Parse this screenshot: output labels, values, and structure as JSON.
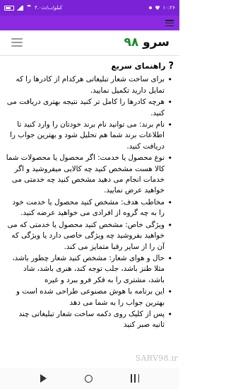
{
  "status_bar": {
    "time": "۱۰:۲۶",
    "speed": "۴.۰کیلو/ب/ث",
    "icons": [
      "heart-icon",
      "notification-dot-icon",
      "signal-icon",
      "wifi-icon",
      "battery-icon"
    ]
  },
  "header": {
    "brand_text": "سرو",
    "brand_number": "۹۸"
  },
  "guide": {
    "title": "راهنمای سریع",
    "items": [
      "برای ساخت شعار تبلیغاتی هرکدام از کادرها را که تمایل دارید تکمیل نمایید.",
      "هرچه کادرها را کامل تر کنید نتیجه بهتری دریافت می کنید.",
      "نام برند: می توانید نام برند خودتان را وارد کنید تا اطلاعات برند شما هم تحلیل شود و بهترین جواب را دریافت کنید.",
      "نوع محصول یا خدمت: اگر محصول یا محصولات شما کالا هست مشخص کنید چه کالایی میفروشید و اگر خدمات انجام می دهید مشخص کنید چه خدمتی می خواهید عرض نمایید.",
      "مخاطب هدف: مشخص کنید محصول یا خدمت خود را به چه گروه از افرادی می خواهید عرضه کنید.",
      "ویژگی خاص: مشخص کنید محصول یا خدمتی که می خواهید بفروشید چه ویژگی خاصی دارد یا ویژگی که آن را از سایر رقبا متمایز می کند.",
      "حال و هوای شعار: مشخص کنید شعار چطور باشد، مثلا طنز باشد، جلب توجه کند، هنری باشد، شاد باشد، مشتری را به فکر فرو ببرد و غیره",
      "این برنامه با هوش مصنوعی طراحی شده است و بهترین جواب را به شما می دهد",
      "پس از کلیک روی دکمه ساخت شعار تبلیغاتی چند ثانیه صبر کنید"
    ]
  },
  "watermark": "SARV98.ir",
  "nav": {
    "icons": [
      "back-icon",
      "home-icon",
      "recents-icon"
    ]
  }
}
